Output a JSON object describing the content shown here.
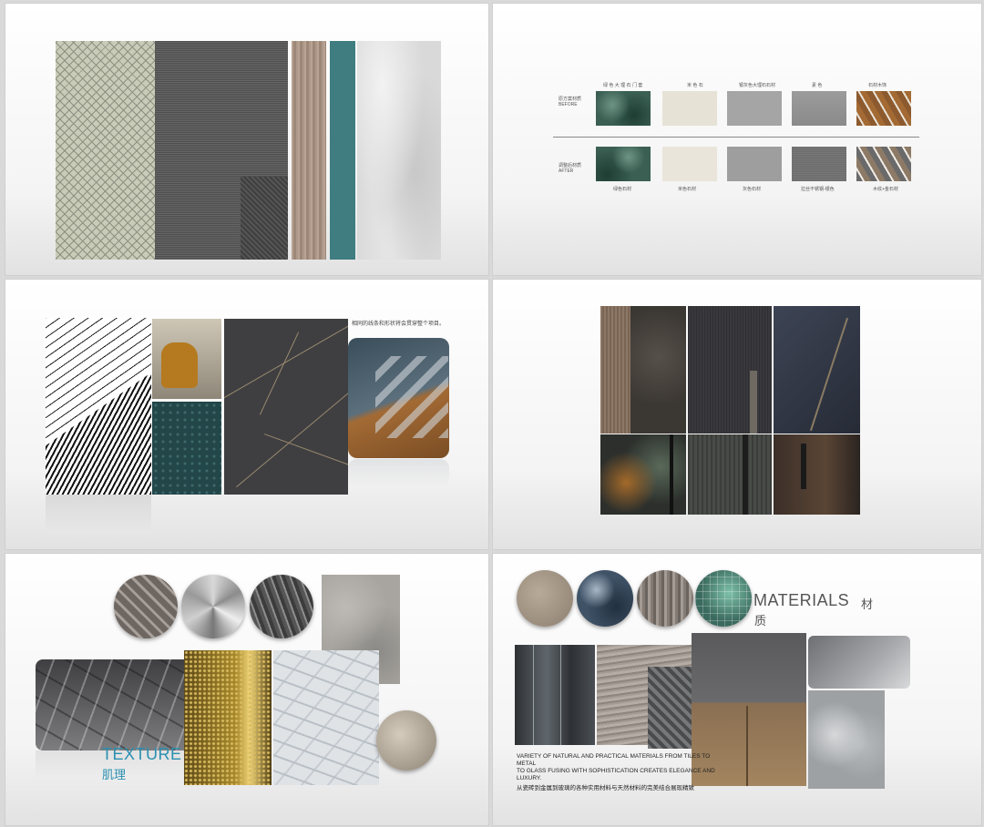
{
  "slide1": {
    "swatches": [
      "chevron-tile",
      "grey-fabric",
      "wood-strip",
      "teal-strip",
      "grey-marble"
    ]
  },
  "slide2": {
    "header_labels": [
      "绿 色 大 理 石 门 套",
      "米 色 石",
      "银灰色大理石石材",
      "素 色",
      "石材木饰"
    ],
    "row_labels": [
      {
        "cn": "原方案材质",
        "en": "BEFORE"
      },
      {
        "cn": "调整后材质",
        "en": "AFTER"
      }
    ],
    "footer_labels": [
      "绿色石材",
      "米色石材",
      "灰色石材",
      "拉丝不锈钢-银色",
      "木纹+金石材"
    ]
  },
  "slide3": {
    "caption": "相同的线条和形状将会贯穿整个项目。"
  },
  "slide5": {
    "title": "TEXTURE",
    "subtitle": "肌理"
  },
  "slide6": {
    "title": "MATERIALS",
    "title_cn_1": "材",
    "title_cn_2": "质",
    "desc_en_1": "VARIETY OF NATURAL AND PRACTICAL MATERIALS FROM TILES TO",
    "desc_en_2": "METAL",
    "desc_en_3": "TO GLASS FUSING WITH SOPHISTICATION CREATES ELEGANCE AND",
    "desc_en_4": "LUXURY.",
    "desc_cn": "从瓷砖到金属到玻璃的各种实用材料与天然材料的完美结合展现精致"
  },
  "colors": {
    "teal": "#3f7d80",
    "texture_title": "#2a8fb0",
    "materials_title": "#555555"
  }
}
